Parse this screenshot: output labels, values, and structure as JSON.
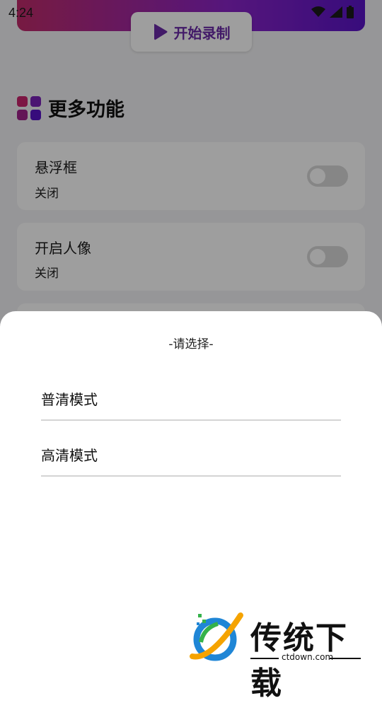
{
  "status": {
    "time": "4:24"
  },
  "record_button": {
    "label": "开始录制"
  },
  "section": {
    "title": "更多功能"
  },
  "cards": [
    {
      "title": "悬浮框",
      "status": "关闭"
    },
    {
      "title": "开启人像",
      "status": "关闭"
    }
  ],
  "dialog": {
    "title": "-请选择-",
    "options": [
      "普清模式",
      "高清模式"
    ]
  },
  "watermark": {
    "brand": "传统下载",
    "url": "ctdown.com"
  },
  "colors": {
    "accent_purple": "#6b2aa8",
    "banner_start": "#c02b6a",
    "banner_end": "#5a14c8"
  }
}
